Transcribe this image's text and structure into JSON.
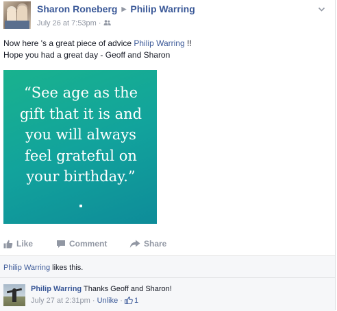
{
  "post": {
    "author": "Sharon Roneberg",
    "target": "Philip Warring",
    "timestamp": "July 26 at 7:53pm",
    "audience_icon": "friends-icon",
    "message_part1": "Now here 's a great piece of advice ",
    "message_link": "Philip Warring",
    "message_part2": " !!",
    "message_line2": "Hope you had a great day - Geoff and Sharon",
    "quote": "“See age as the gift that it is and you will always feel grateful on your birthday.”"
  },
  "actions": {
    "like": "Like",
    "comment": "Comment",
    "share": "Share"
  },
  "likes": {
    "name": "Philip Warring",
    "suffix": " likes this."
  },
  "comment": {
    "author": "Philip Warring",
    "text": " Thanks Geoff and Sharon!",
    "timestamp": "July 27 at 2:31pm",
    "separator": "·",
    "unlike": "Unlike",
    "like_count": "1"
  },
  "colors": {
    "link": "#3b5998",
    "muted": "#9197a3",
    "quote_bg_start": "#19b28e",
    "quote_bg_end": "#0e8c99"
  }
}
